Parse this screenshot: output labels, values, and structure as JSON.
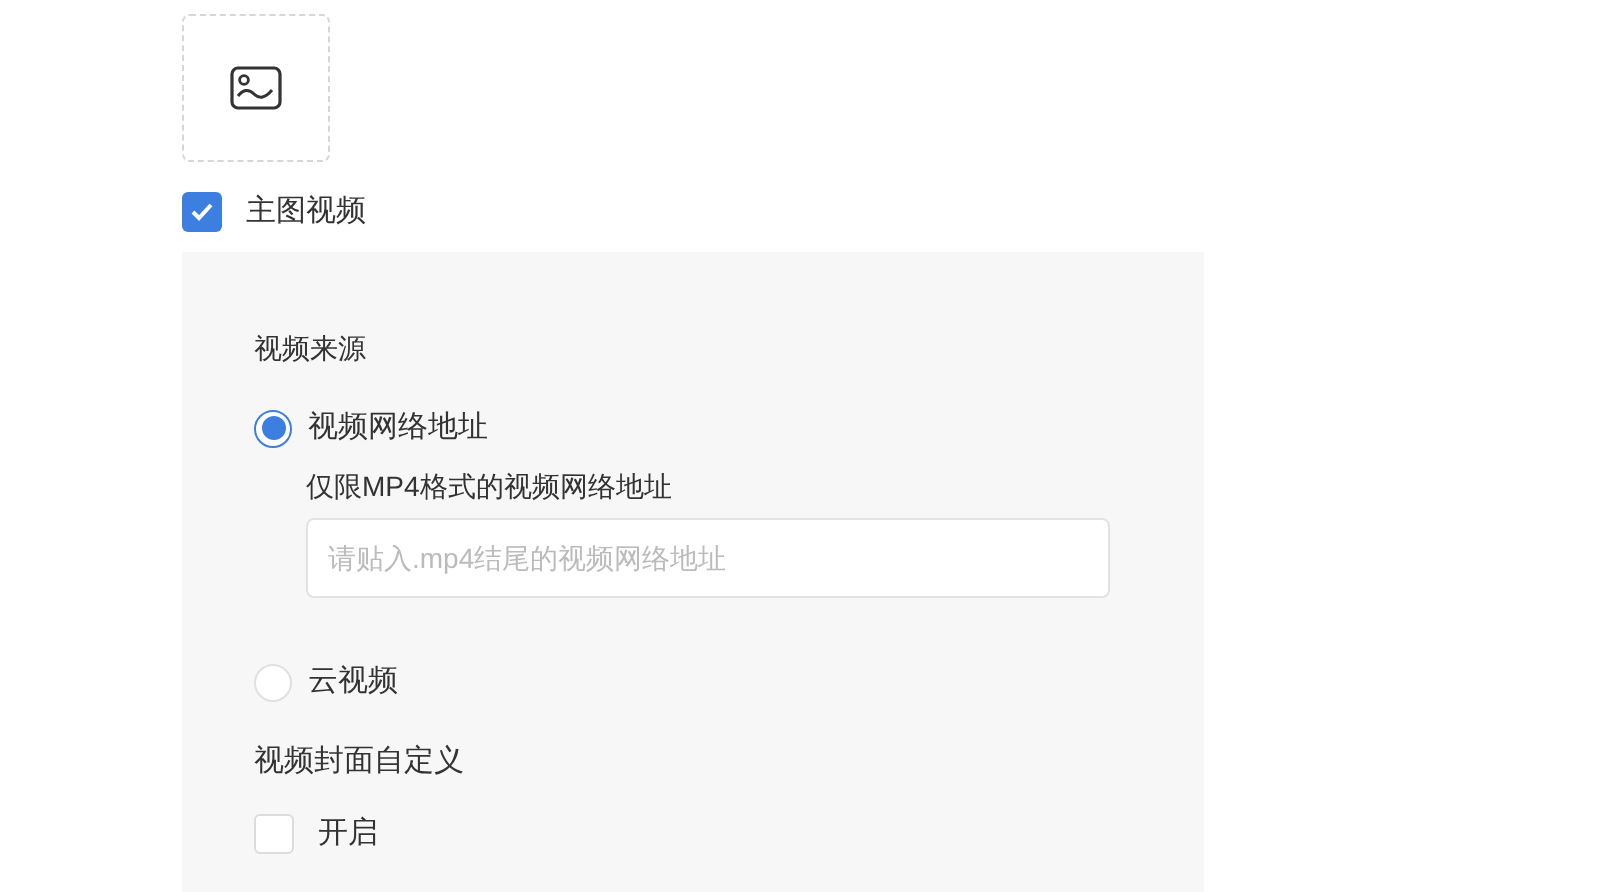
{
  "main_video": {
    "label": "主图视频",
    "checked": true
  },
  "panel": {
    "source_label": "视频来源",
    "sources": [
      {
        "label": "视频网络地址",
        "selected": true,
        "hint": "仅限MP4格式的视频网络地址",
        "placeholder": "请贴入.mp4结尾的视频网络地址"
      },
      {
        "label": "云视频",
        "selected": false
      }
    ],
    "cover_label": "视频封面自定义",
    "cover_toggle": {
      "label": "开启",
      "checked": false
    }
  }
}
